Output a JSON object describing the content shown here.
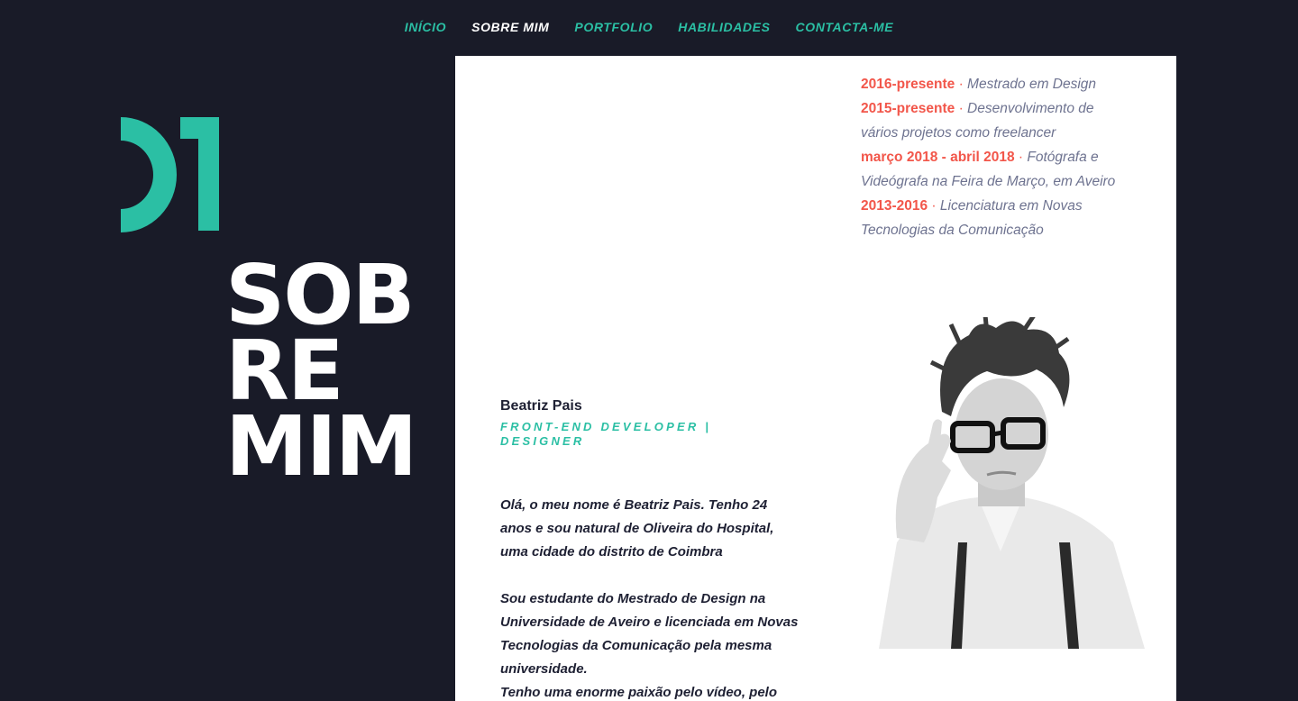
{
  "nav": {
    "items": [
      {
        "label": "INÍCIO"
      },
      {
        "label": "SOBRE MIM"
      },
      {
        "label": "PORTFOLIO"
      },
      {
        "label": "HABILIDADES"
      },
      {
        "label": "CONTACTA-ME"
      }
    ],
    "active": "SOBRE MIM"
  },
  "section": {
    "number": "01",
    "heading_lines": [
      "SOB",
      "RE",
      "MIM"
    ]
  },
  "timeline": [
    {
      "date": "2016-presente",
      "sep": " · ",
      "text": "Mestrado em Design"
    },
    {
      "date": "2015-presente",
      "sep": " · ",
      "text": "Desenvolvimento de vários projetos como freelancer"
    },
    {
      "date": "março 2018 - abril 2018",
      "sep": " · ",
      "text": "Fotógrafa e Videógrafa na Feira de Março, em Aveiro"
    },
    {
      "date": "2013-2016",
      "sep": " · ",
      "text": "Licenciatura em Novas Tecnologias da Comunicação"
    }
  ],
  "profile": {
    "name": "Beatriz Pais",
    "role": "FRONT-END DEVELOPER | DESIGNER",
    "bio": [
      "Olá, o meu nome é Beatriz Pais. Tenho 24 anos e sou natural de Oliveira do Hospital, uma cidade do distrito de Coimbra",
      "Sou estudante do Mestrado de Design na Universidade de Aveiro e licenciada em Novas Tecnologias da Comunicação pela mesma universidade.",
      "Tenho uma enorme paixão pelo vídeo, pelo"
    ]
  },
  "colors": {
    "background": "#191b28",
    "accent": "#2bbfa4",
    "highlight": "#f2564a",
    "card": "#ffffff"
  }
}
